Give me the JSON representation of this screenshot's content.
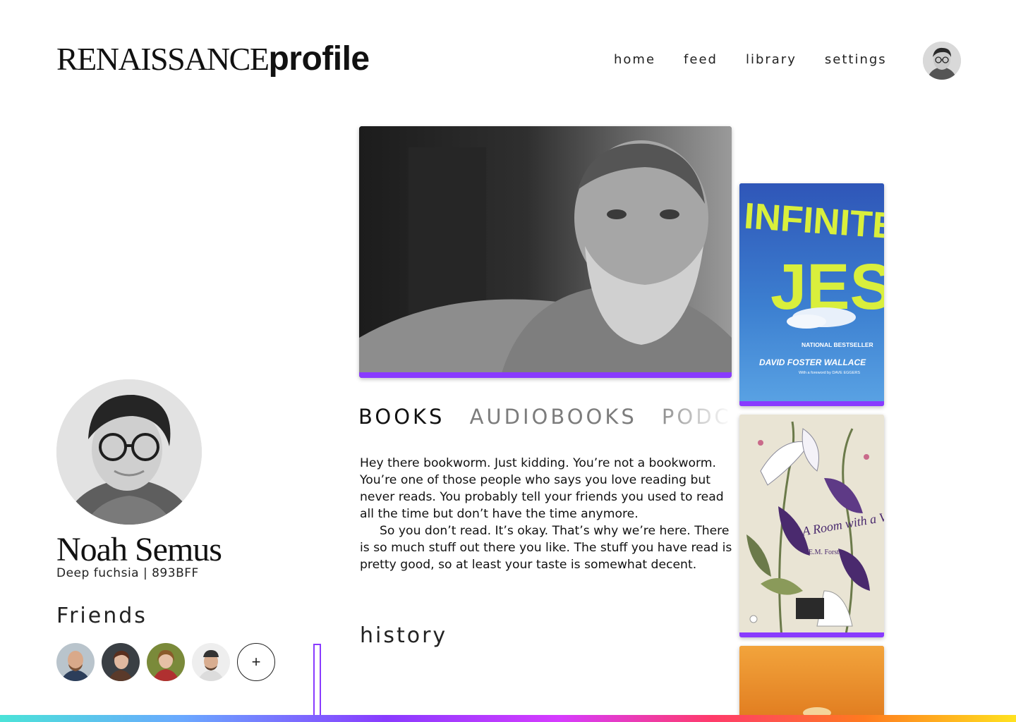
{
  "header": {
    "logo_serif": "RENAISSANCE",
    "logo_bold": "profile",
    "nav": [
      {
        "label": "home"
      },
      {
        "label": "feed"
      },
      {
        "label": "library"
      },
      {
        "label": "settings"
      }
    ]
  },
  "profile": {
    "name": "Noah Semus",
    "color_line": "Deep fuchsia | 893BFF",
    "accent_color": "#893BFF"
  },
  "friends": {
    "title": "Friends",
    "add_label": "+"
  },
  "tabs": [
    {
      "label": "BOOKS",
      "active": true
    },
    {
      "label": "AUDIOBOOKS",
      "active": false
    },
    {
      "label": "PODCASTS",
      "active": false
    }
  ],
  "description": {
    "p1": "Hey there bookworm. Just kidding. You’re not a bookworm. You’re one of those people who says you love reading but never reads. You probably tell your friends you used to read all the time but don’t have the time anymore.",
    "p2": "So you don’t read. It’s okay. That’s why we’re here. There is so much stuff out there you like. The stuff you have read is pretty good, so at least your taste is somewhat decent."
  },
  "history": {
    "title": "history"
  },
  "books": [
    {
      "title": "INFINITE JEST",
      "badge": "NATIONAL BESTSELLER",
      "author": "DAVID FOSTER WALLACE",
      "foreword": "With a foreword by DAVE EGGERS"
    },
    {
      "title": "A Room with a View",
      "author": "E.M. Forster"
    }
  ]
}
